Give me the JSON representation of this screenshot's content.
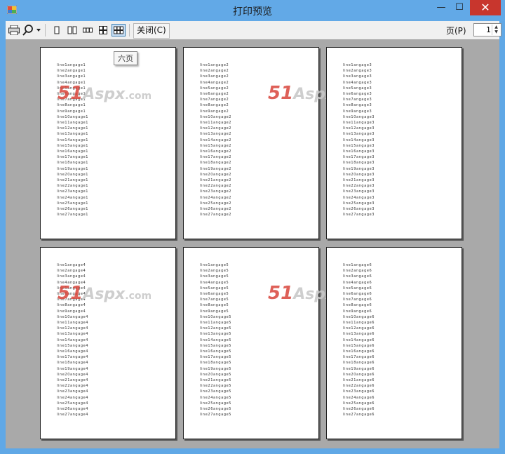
{
  "window": {
    "title": "打印预览",
    "minimize": "—",
    "maximize": "☐",
    "close": "✕"
  },
  "toolbar": {
    "close_label": "关闭(C)",
    "page_label": "页(P)",
    "page_value": "1",
    "spin_up": "▲",
    "spin_down": "▼"
  },
  "tooltip": "六页",
  "watermark": {
    "part1": "51",
    "part2": "Aspx",
    "part3": ".com"
  },
  "pages": [
    {
      "lines": [
        "line1angage1",
        "line2angage1",
        "line3angage1",
        "line4angage1",
        "line5angage1",
        "line6angage1",
        "line7angage1",
        "line8angage1",
        "line9angage1",
        "line10angage1",
        "line11angage1",
        "line12angage1",
        "line13angage1",
        "line14angage1",
        "line15angage1",
        "line16angage1",
        "line17angage1",
        "line18angage1",
        "line19angage1",
        "line20angage1",
        "line21angage1",
        "line22angage1",
        "line23angage1",
        "line24angage1",
        "line25angage1",
        "line26angage1",
        "line27angage1"
      ]
    },
    {
      "lines": [
        "line1angage2",
        "line2angage2",
        "line3angage2",
        "line4angage2",
        "line5angage2",
        "line6angage2",
        "line7angage2",
        "line8angage2",
        "line9angage2",
        "line10angage2",
        "line11angage2",
        "line12angage2",
        "line13angage2",
        "line14angage2",
        "line15angage2",
        "line16angage2",
        "line17angage2",
        "line18angage2",
        "line19angage2",
        "line20angage2",
        "line21angage2",
        "line22angage2",
        "line23angage2",
        "line24angage2",
        "line25angage2",
        "line26angage2",
        "line27angage2"
      ]
    },
    {
      "lines": [
        "line1angage3",
        "line2angage3",
        "line3angage3",
        "line4angage3",
        "line5angage3",
        "line6angage3",
        "line7angage3",
        "line8angage3",
        "line9angage3",
        "line10angage3",
        "line11angage3",
        "line12angage3",
        "line13angage3",
        "line14angage3",
        "line15angage3",
        "line16angage3",
        "line17angage3",
        "line18angage3",
        "line19angage3",
        "line20angage3",
        "line21angage3",
        "line22angage3",
        "line23angage3",
        "line24angage3",
        "line25angage3",
        "line26angage3",
        "line27angage3"
      ]
    },
    {
      "lines": [
        "line1angage4",
        "line2angage4",
        "line3angage4",
        "line4angage4",
        "line5angage4",
        "line6angage4",
        "line7angage4",
        "line8angage4",
        "line9angage4",
        "line10angage4",
        "line11angage4",
        "line12angage4",
        "line13angage4",
        "line14angage4",
        "line15angage4",
        "line16angage4",
        "line17angage4",
        "line18angage4",
        "line19angage4",
        "line20angage4",
        "line21angage4",
        "line22angage4",
        "line23angage4",
        "line24angage4",
        "line25angage4",
        "line26angage4",
        "line27angage4"
      ]
    },
    {
      "lines": [
        "line1angage5",
        "line2angage5",
        "line3angage5",
        "line4angage5",
        "line5angage5",
        "line6angage5",
        "line7angage5",
        "line8angage5",
        "line9angage5",
        "line10angage5",
        "line11angage5",
        "line12angage5",
        "line13angage5",
        "line14angage5",
        "line15angage5",
        "line16angage5",
        "line17angage5",
        "line18angage5",
        "line19angage5",
        "line20angage5",
        "line21angage5",
        "line22angage5",
        "line23angage5",
        "line24angage5",
        "line25angage5",
        "line26angage5",
        "line27angage5"
      ]
    },
    {
      "lines": [
        "line1angage6",
        "line2angage6",
        "line3angage6",
        "line4angage6",
        "line5angage6",
        "line6angage6",
        "line7angage6",
        "line8angage6",
        "line9angage6",
        "line10angage6",
        "line11angage6",
        "line12angage6",
        "line13angage6",
        "line14angage6",
        "line15angage6",
        "line16angage6",
        "line17angage6",
        "line18angage6",
        "line19angage6",
        "line20angage6",
        "line21angage6",
        "line22angage6",
        "line23angage6",
        "line24angage6",
        "line25angage6",
        "line26angage6",
        "line27angage6"
      ]
    }
  ]
}
